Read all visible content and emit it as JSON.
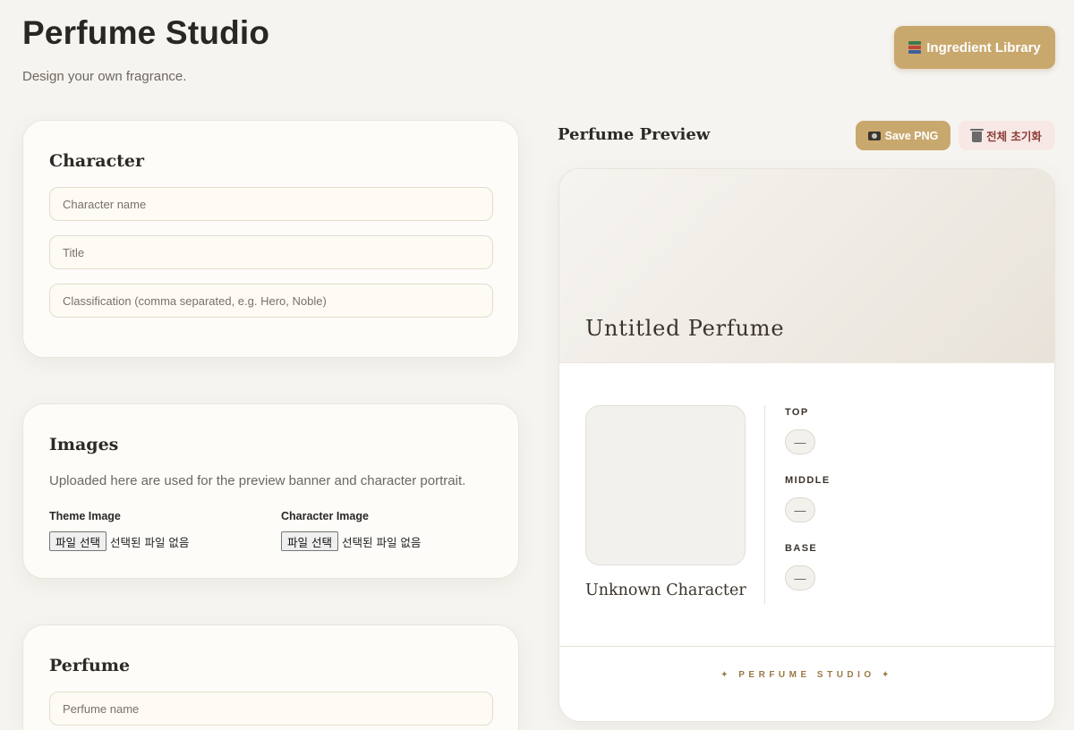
{
  "header": {
    "title": "Perfume Studio",
    "subtitle": "Design your own fragrance.",
    "library_button": "Ingredient Library",
    "library_icon": "books-icon"
  },
  "character_card": {
    "title": "Character",
    "name_placeholder": "Character name",
    "title_placeholder": "Title",
    "classification_placeholder": "Classification (comma separated, e.g. Hero, Noble)"
  },
  "images_card": {
    "title": "Images",
    "description": "Uploaded here are used for the preview banner and character portrait.",
    "theme_label": "Theme Image",
    "character_label": "Character Image",
    "file_button": "파일 선택",
    "file_status": "선택된 파일 없음"
  },
  "perfume_card": {
    "title": "Perfume",
    "name_placeholder": "Perfume name"
  },
  "preview": {
    "heading": "Perfume Preview",
    "save_button": "Save PNG",
    "reset_button": "전체 초기화",
    "perfume_name": "Untitled Perfume",
    "character_name": "Unknown Character",
    "notes": [
      {
        "label": "TOP",
        "value": "—"
      },
      {
        "label": "MIDDLE",
        "value": "—"
      },
      {
        "label": "BASE",
        "value": "—"
      }
    ],
    "footer": "✦ PERFUME STUDIO ✦"
  },
  "colors": {
    "accent": "#c9a86e",
    "background": "#f6f4f0",
    "danger_bg": "#f7e8e6",
    "danger_text": "#8c3b34"
  }
}
